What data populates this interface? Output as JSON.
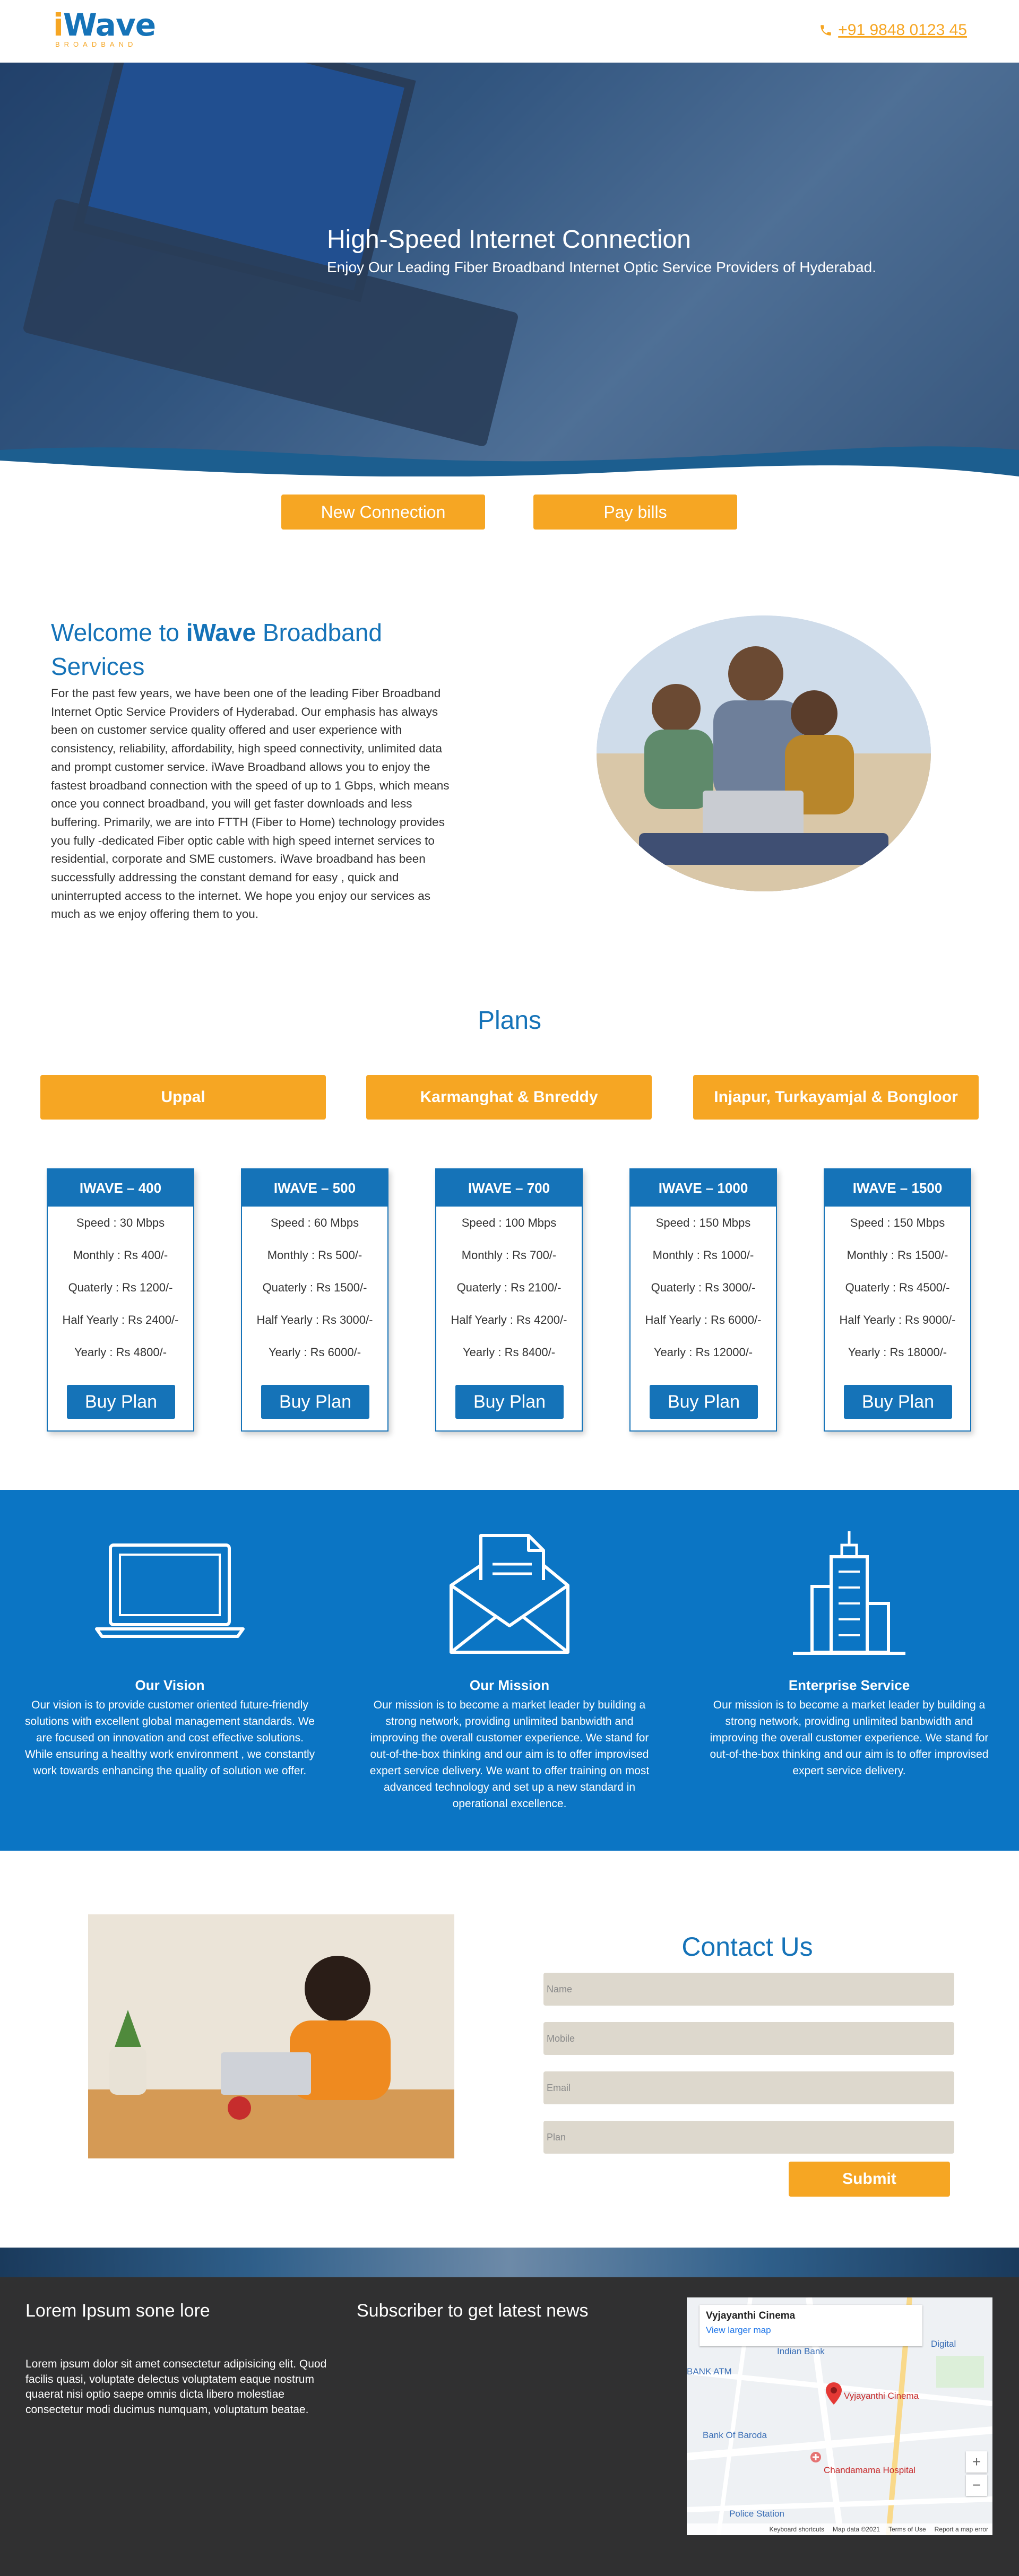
{
  "header": {
    "logo": {
      "word_i": "i",
      "word_rest": "Wave",
      "sub": "BROADBAND"
    },
    "phone": "+91 9848 0123 45",
    "phone_icon": "phone-icon",
    "accent": "#f6a623",
    "brand": "#1573b8"
  },
  "hero": {
    "title": "High-Speed Internet Connection",
    "subtitle": "Enjoy Our Leading Fiber Broadband Internet Optic Service Providers of Hyderabad."
  },
  "cta": {
    "new_connection": "New Connection",
    "pay_bills": "Pay bills"
  },
  "welcome": {
    "title_pre": "Welcome to ",
    "title_brand": "iWave",
    "title_post": " Broadband Services",
    "paragraph": "For the past few years, we have been one of the leading Fiber Broadband Internet Optic Service Providers of Hyderabad. Our emphasis has always been on customer service quality offered and user experience with consistency, reliability, affordability, high speed connectivity, unlimited data and prompt customer service. iWave Broadband allows you to enjoy the fastest broadband connection with the speed of up to 1 Gbps, which means once you connect broadband, you will get faster downloads and less buffering. Primarily, we are into FTTH (Fiber to Home) technology provides you fully -dedicated Fiber optic cable with high speed internet services to residential, corporate and SME customers. iWave broadband has been successfully addressing the constant demand for easy , quick and uninterrupted access to the internet. We hope you enjoy our services as much as we enjoy offering them to you."
  },
  "plans": {
    "title": "Plans",
    "areas": [
      "Uppal",
      "Karmanghat & Bnreddy",
      "Injapur, Turkayamjal & Bongloor"
    ],
    "buy_label": "Buy Plan",
    "cards": [
      {
        "name": "IWAVE – 400",
        "speed": "Speed : 30 Mbps",
        "monthly": "Monthly : Rs 400/-",
        "quarterly": "Quaterly : Rs 1200/-",
        "half": "Half Yearly : Rs 2400/-",
        "yearly": "Yearly : Rs 4800/-"
      },
      {
        "name": "IWAVE – 500",
        "speed": "Speed : 60 Mbps",
        "monthly": "Monthly : Rs 500/-",
        "quarterly": "Quaterly : Rs 1500/-",
        "half": "Half Yearly : Rs 3000/-",
        "yearly": "Yearly : Rs 6000/-"
      },
      {
        "name": "IWAVE – 700",
        "speed": "Speed : 100 Mbps",
        "monthly": "Monthly : Rs 700/-",
        "quarterly": "Quaterly : Rs 2100/-",
        "half": "Half Yearly : Rs 4200/-",
        "yearly": "Yearly : Rs 8400/-"
      },
      {
        "name": "IWAVE – 1000",
        "speed": "Speed : 150 Mbps",
        "monthly": "Monthly : Rs 1000/-",
        "quarterly": "Quaterly : Rs 3000/-",
        "half": "Half Yearly : Rs 6000/-",
        "yearly": "Yearly : Rs 12000/-"
      },
      {
        "name": "IWAVE – 1500",
        "speed": "Speed : 150 Mbps",
        "monthly": "Monthly : Rs 1500/-",
        "quarterly": "Quaterly : Rs 4500/-",
        "half": "Half Yearly : Rs 9000/-",
        "yearly": "Yearly : Rs 18000/-"
      }
    ]
  },
  "mission": {
    "vision": {
      "title": "Our Vision",
      "icon": "laptop-icon",
      "text": "Our vision is to provide customer oriented future-friendly solutions with excellent global management standards. We are focused on innovation and cost effective solutions. While ensuring a healthy work environment , we constantly work towards enhancing the quality of solution we offer."
    },
    "mission": {
      "title": "Our Mission",
      "icon": "envelope-icon",
      "text": "Our mission is to become a market leader by building a strong network, providing unlimited banbwidth and improving the overall customer experience. We stand for out-of-the-box thinking and our aim is to offer improvised expert service delivery. We want to offer training on most advanced technology and set up a new standard in operational excellence."
    },
    "enterprise": {
      "title": "Enterprise Service",
      "icon": "building-icon",
      "text": "Our mission is to become a market leader by building a strong network, providing unlimited banbwidth and improving the overall customer experience. We stand for out-of-the-box thinking and our aim is to offer improvised expert service delivery."
    }
  },
  "contact": {
    "title": "Contact Us",
    "fields": {
      "name": "Name",
      "mobile": "Mobile",
      "email": "Email",
      "plan": "Plan"
    },
    "submit": "Submit"
  },
  "footer": {
    "col1_title": "Lorem Ipsum sone lore",
    "col1_text": "Lorem ipsum dolor sit amet consectetur adipisicing elit. Quod facilis quasi, voluptate delectus voluptatem eaque nostrum quaerat nisi optio saepe omnis dicta libero molestiae consectetur modi ducimus numquam, voluptatum beatae.",
    "col2_title": "Subscriber to get latest news",
    "map": {
      "place": "Vyjayanthi Cinema",
      "link": "View larger map",
      "labels": {
        "digital": "Digital",
        "indian_bank": "Indian Bank",
        "bank_atm": "BANK ATM",
        "bank_of_baroda": "Bank Of Baroda",
        "cinema": "Vyjayanthi Cinema",
        "hospital": "Chandamama Hospital",
        "police": "Police Station"
      },
      "zoom_in": "+",
      "zoom_out": "−",
      "footer": {
        "shortcuts": "Keyboard shortcuts",
        "mapdata": "Map data ©2021",
        "terms": "Terms of Use",
        "report": "Report a map error"
      }
    }
  }
}
